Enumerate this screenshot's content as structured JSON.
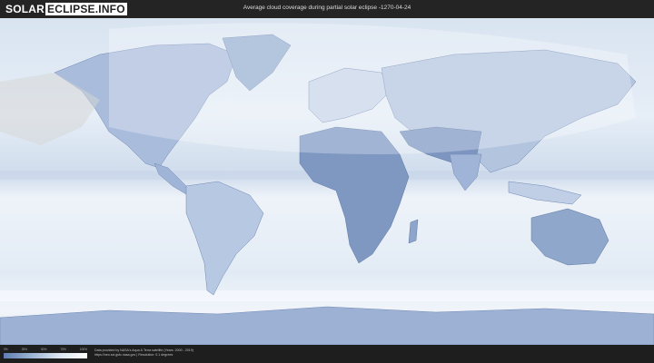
{
  "header": {
    "logo_part1": "SOLAR",
    "logo_part2": "ECLIPSE.INFO",
    "title": "Average cloud coverage during partial solar eclipse -1270-04-24"
  },
  "legend": {
    "ticks": [
      "0%",
      "25%",
      "50%",
      "75%",
      "100%"
    ],
    "colors": [
      "#5f7eb0",
      "#9cb3d3",
      "#dbe5f1",
      "#ffffff"
    ]
  },
  "footer": {
    "credit_line1": "Data provided by NASA's Aqua & Terra satellite (Years: 2000 - 2019)",
    "credit_line2": "https://neo.sci.gsfc.nasa.gov | Resolution: 0.1 degrees"
  },
  "map": {
    "ocean_color": "#dbe5f1",
    "land_cloudless_color": "#7f98c2",
    "eclipse_overlay_color": "#ffffff"
  }
}
